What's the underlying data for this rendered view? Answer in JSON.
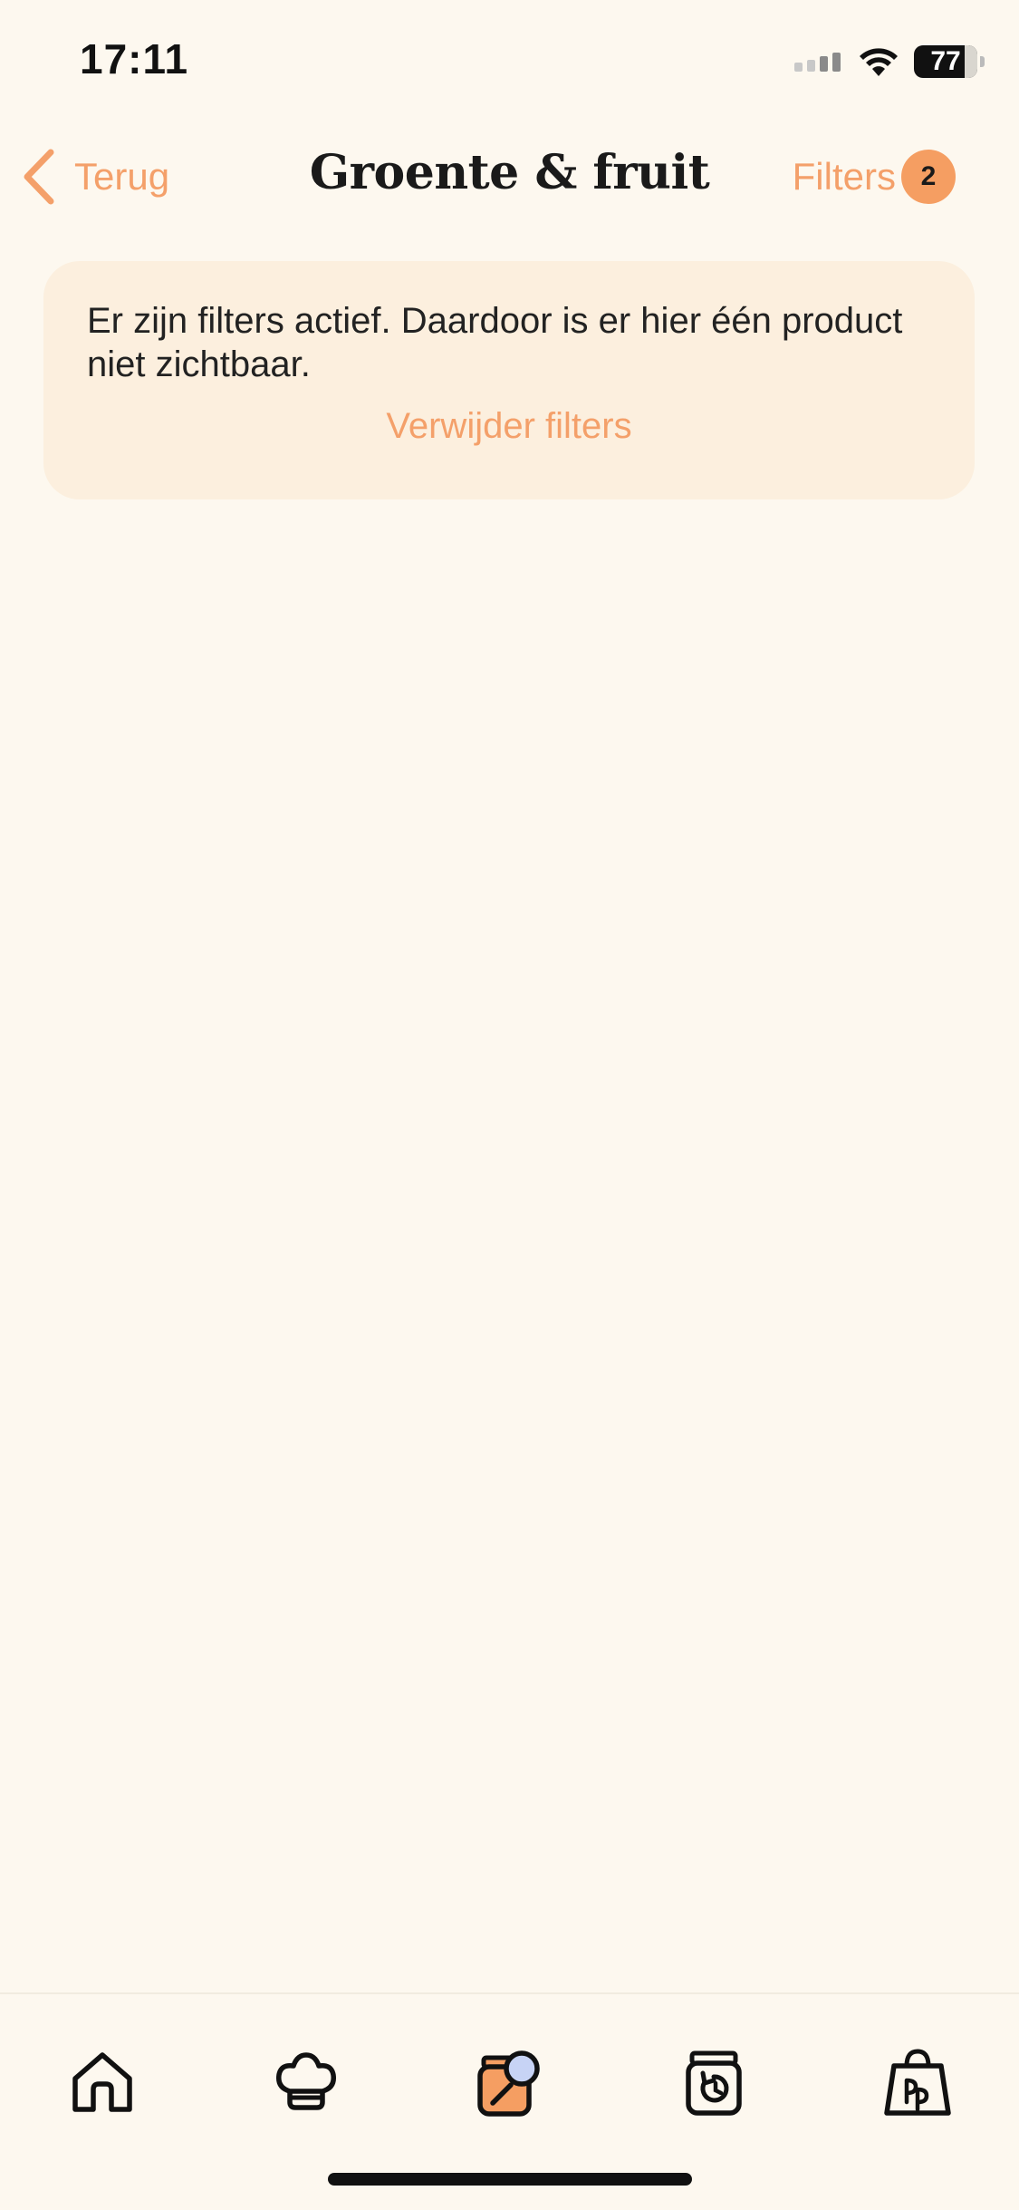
{
  "status_bar": {
    "time": "17:11",
    "battery": "77"
  },
  "header": {
    "back_label": "Terug",
    "title": "Groente & fruit",
    "filters_label": "Filters",
    "filters_count": "2"
  },
  "notice": {
    "message": "Er zijn filters actief. Daardoor is er hier één product niet zichtbaar.",
    "action_label": "Verwijder filters"
  },
  "tab_bar": {
    "items": [
      {
        "icon": "home-icon",
        "active": false
      },
      {
        "icon": "chef-hat-icon",
        "active": false
      },
      {
        "icon": "products-search-icon",
        "active": true
      },
      {
        "icon": "reorder-jar-icon",
        "active": false
      },
      {
        "icon": "shopping-bag-icon",
        "active": false
      }
    ]
  },
  "colors": {
    "background": "#FDF8EF",
    "accent": "#F4A06A",
    "badge": "#F59E62",
    "notice_background": "#FCEFDE",
    "search_lens": "#C7D3F5"
  }
}
